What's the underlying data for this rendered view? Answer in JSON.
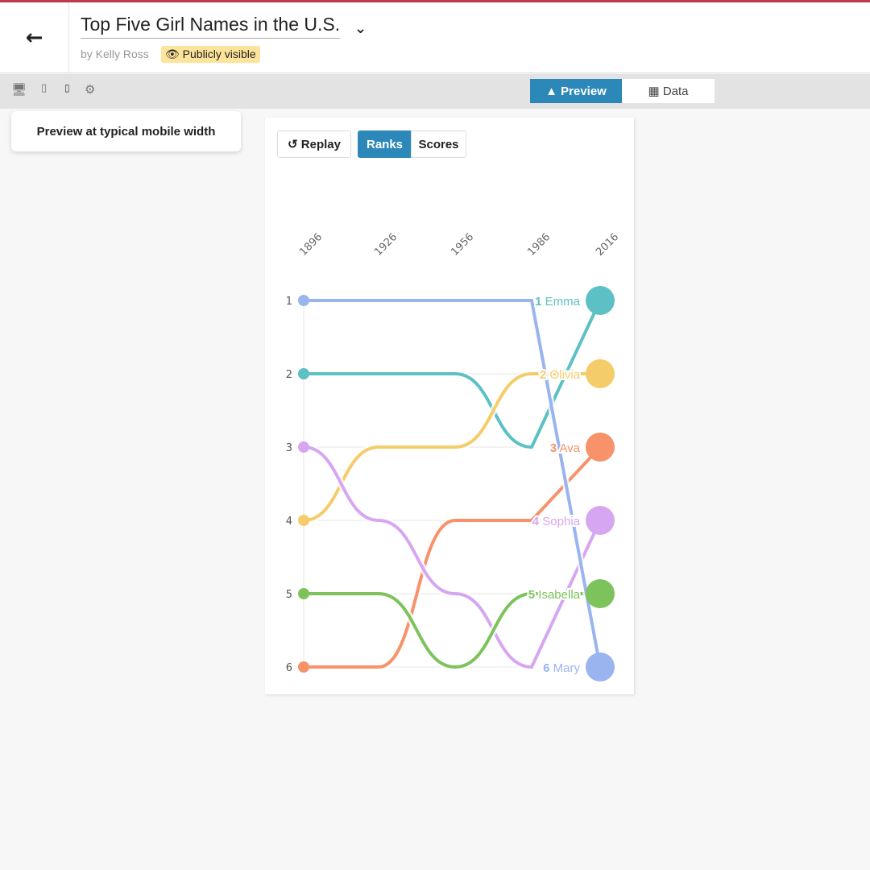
{
  "header": {
    "title": "Top Five Girl Names in the U.S.",
    "byline": "by Kelly Ross",
    "visibility": "Publicly visible"
  },
  "toolbar": {
    "preview_label": "Preview",
    "data_label": "Data",
    "tooltip": "Preview at typical mobile width",
    "active_tab": "Preview",
    "accent": "#2b88b9"
  },
  "chart_controls": {
    "replay": "Replay",
    "ranks": "Ranks",
    "scores": "Scores",
    "active": "Ranks"
  },
  "chart_data": {
    "type": "line",
    "x": [
      "1896",
      "1926",
      "1956",
      "1986",
      "2016"
    ],
    "y_ticks": [
      "1",
      "2",
      "3",
      "4",
      "5",
      "6"
    ],
    "y_axis": "rank (1 at top)",
    "grid": true,
    "series": [
      {
        "name": "Emma",
        "color": "#5cc0c4",
        "values": [
          2,
          2,
          2,
          3,
          1
        ]
      },
      {
        "name": "Olivia",
        "color": "#f5cc6a",
        "values": [
          4,
          3,
          3,
          2,
          2
        ]
      },
      {
        "name": "Ava",
        "color": "#f7926a",
        "values": [
          6,
          6,
          4,
          4,
          3
        ]
      },
      {
        "name": "Sophia",
        "color": "#d7a6f2",
        "values": [
          3,
          4,
          5,
          6,
          4
        ]
      },
      {
        "name": "Isabella",
        "color": "#7dc35b",
        "values": [
          5,
          5,
          6,
          5,
          5
        ]
      },
      {
        "name": "Mary",
        "color": "#99b4ef",
        "values": [
          1,
          1,
          1,
          1,
          6
        ]
      }
    ]
  }
}
